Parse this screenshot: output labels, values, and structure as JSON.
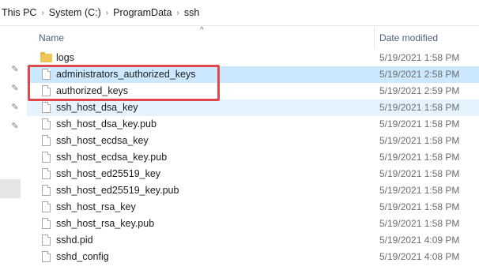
{
  "breadcrumb": {
    "items": [
      "This PC",
      "System (C:)",
      "ProgramData",
      "ssh"
    ],
    "separator": "›"
  },
  "columns": {
    "name": "Name",
    "date_modified": "Date modified",
    "sort_indicator": "^"
  },
  "files": [
    {
      "name": "logs",
      "date": "5/19/2021 1:58 PM",
      "type": "folder"
    },
    {
      "name": "administrators_authorized_keys",
      "date": "5/19/2021 2:58 PM",
      "type": "file",
      "selected": true
    },
    {
      "name": "authorized_keys",
      "date": "5/19/2021 2:59 PM",
      "type": "file"
    },
    {
      "name": "ssh_host_dsa_key",
      "date": "5/19/2021 1:58 PM",
      "type": "file",
      "hover": true
    },
    {
      "name": "ssh_host_dsa_key.pub",
      "date": "5/19/2021 1:58 PM",
      "type": "file"
    },
    {
      "name": "ssh_host_ecdsa_key",
      "date": "5/19/2021 1:58 PM",
      "type": "file"
    },
    {
      "name": "ssh_host_ecdsa_key.pub",
      "date": "5/19/2021 1:58 PM",
      "type": "file"
    },
    {
      "name": "ssh_host_ed25519_key",
      "date": "5/19/2021 1:58 PM",
      "type": "file"
    },
    {
      "name": "ssh_host_ed25519_key.pub",
      "date": "5/19/2021 1:58 PM",
      "type": "file"
    },
    {
      "name": "ssh_host_rsa_key",
      "date": "5/19/2021 1:58 PM",
      "type": "file"
    },
    {
      "name": "ssh_host_rsa_key.pub",
      "date": "5/19/2021 1:58 PM",
      "type": "file"
    },
    {
      "name": "sshd.pid",
      "date": "5/19/2021 4:09 PM",
      "type": "file"
    },
    {
      "name": "sshd_config",
      "date": "5/19/2021 4:08 PM",
      "type": "file"
    }
  ],
  "colors": {
    "selected_row": "#cce8ff",
    "hover_row": "#e5f3ff",
    "highlight_box": "#e0484c",
    "folder": "#f0c55a"
  }
}
